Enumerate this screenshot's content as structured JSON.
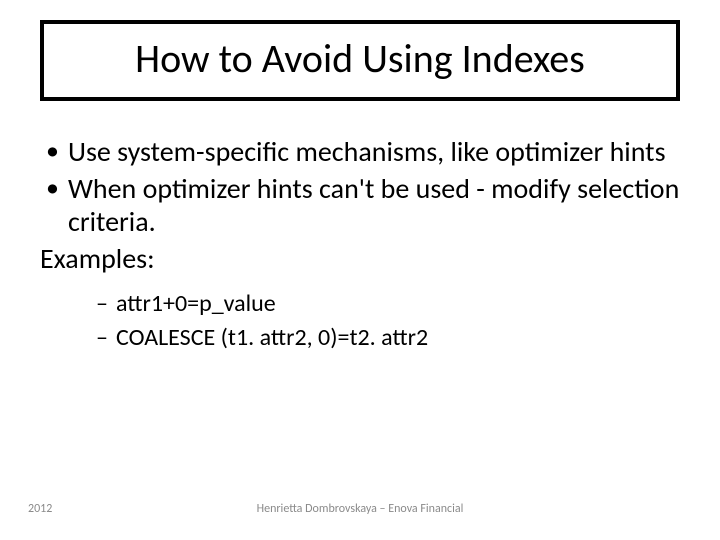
{
  "title": "How to Avoid Using Indexes",
  "bullets": {
    "b1": "Use system-specific mechanisms, like optimizer hints",
    "b2": "When optimizer hints can't be used - modify selection criteria."
  },
  "examples_label": "Examples:",
  "examples": {
    "e1": "attr1+0=p_value",
    "e2": "COALESCE (t1. attr2, 0)=t2. attr2"
  },
  "footer": {
    "year": "2012",
    "credit": "Henrietta Dombrovskaya – Enova Financial"
  }
}
